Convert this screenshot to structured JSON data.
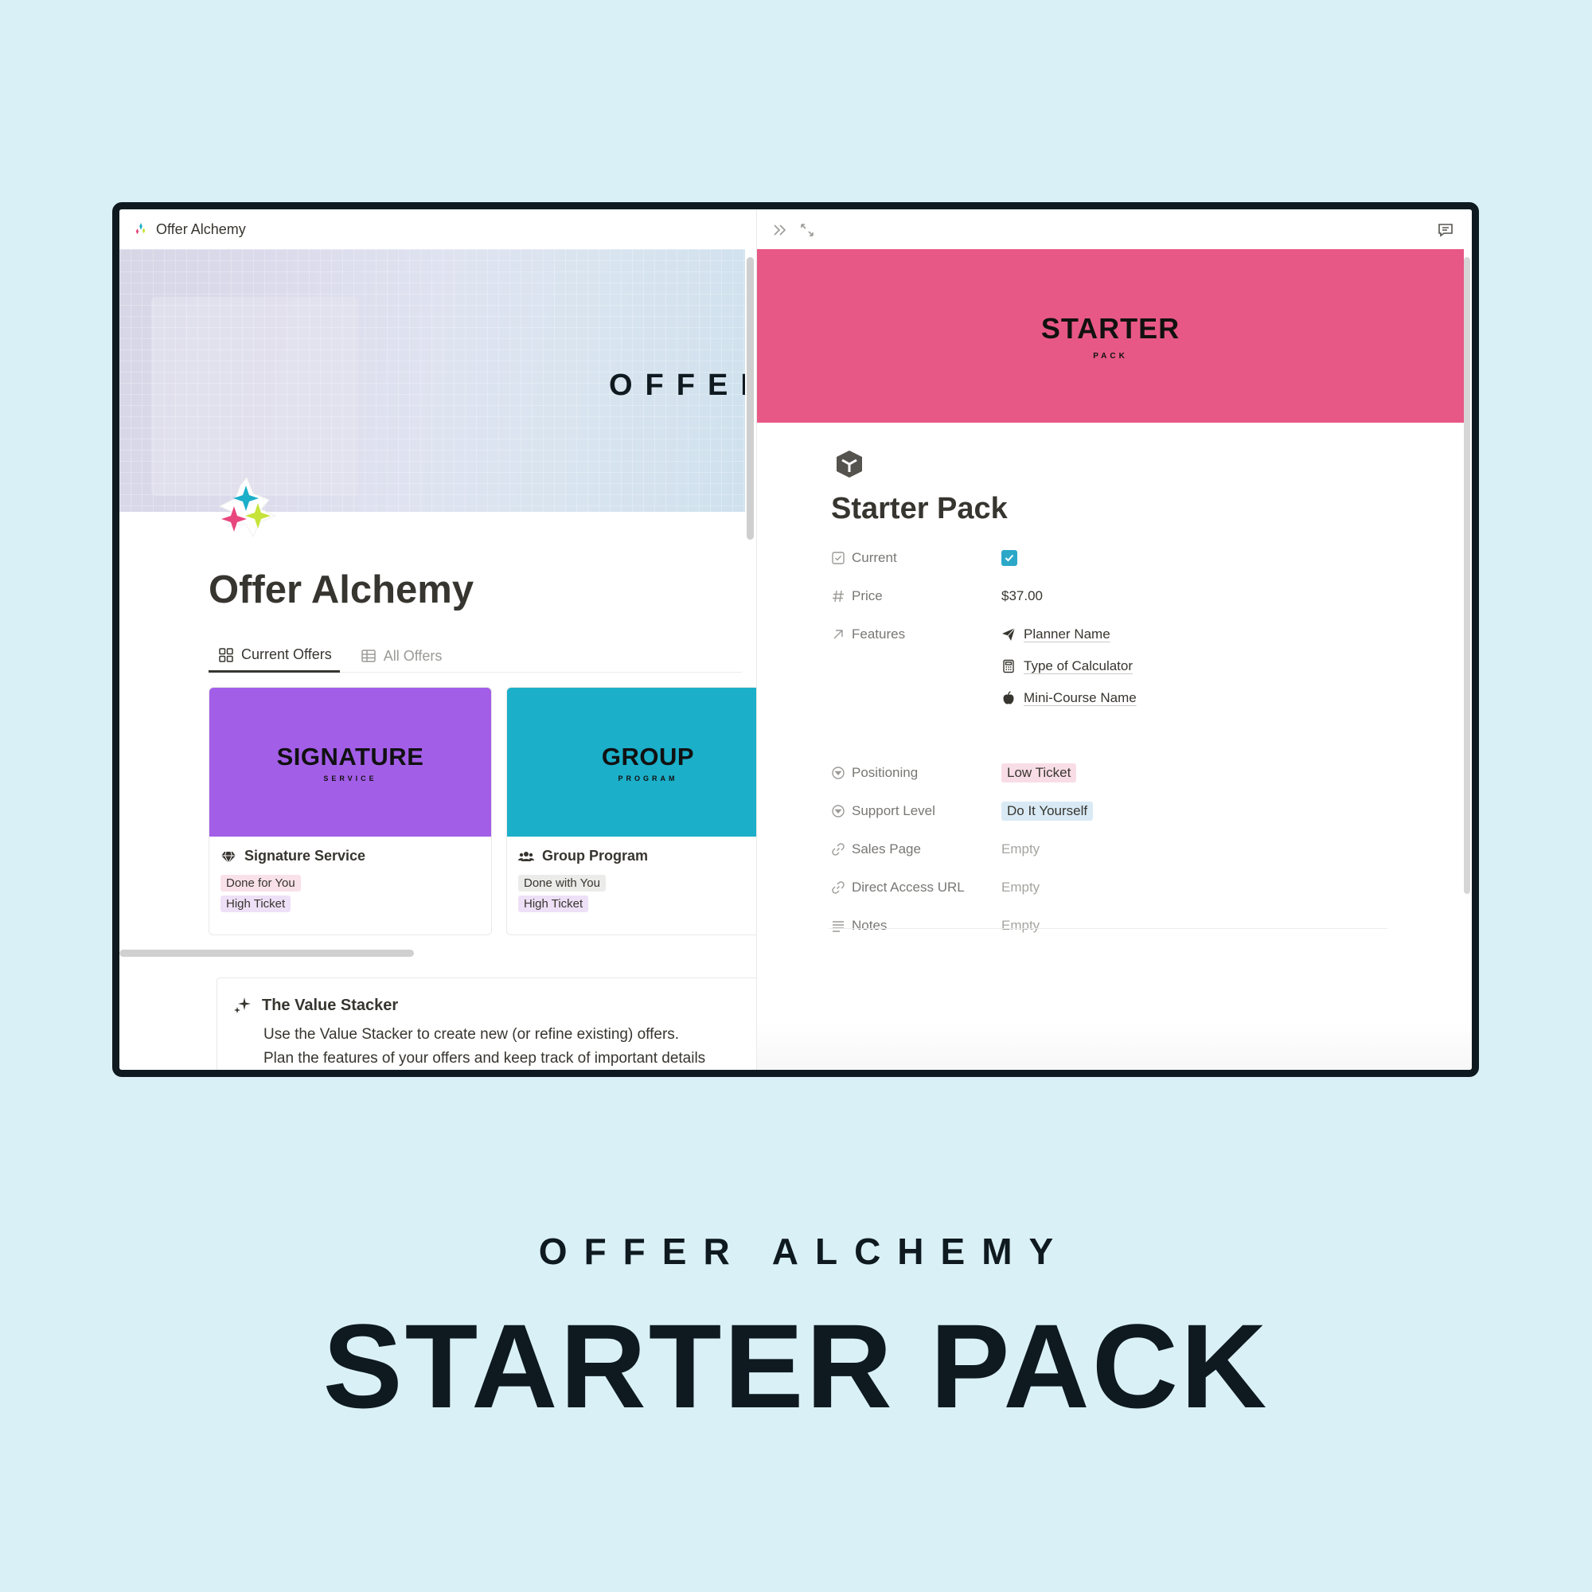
{
  "app": {
    "breadcrumb_title": "Offer Alchemy"
  },
  "left": {
    "cover_word": "OFFER",
    "page_title": "Offer Alchemy",
    "tabs": [
      {
        "label": "Current Offers",
        "active": true,
        "icon": "gallery-icon"
      },
      {
        "label": "All Offers",
        "active": false,
        "icon": "table-icon"
      }
    ],
    "cards": [
      {
        "banner_big": "SIGNATURE",
        "banner_small": "SERVICE",
        "banner_color": "#a35ee8",
        "name": "Signature Service",
        "icon": "diamond-icon",
        "tags": [
          "Done for You",
          "High Ticket"
        ]
      },
      {
        "banner_big": "GROUP",
        "banner_small": "PROGRAM",
        "banner_color": "#1bafc9",
        "name": "Group Program",
        "icon": "people-icon",
        "tags": [
          "Done with You",
          "High Ticket"
        ]
      }
    ],
    "callout": {
      "title": "The Value Stacker",
      "line1": "Use the Value Stacker to create new (or refine existing) offers.",
      "line2": "Plan the features of your offers and keep track of important details"
    }
  },
  "right": {
    "cover_big": "STARTER",
    "cover_small": "PACK",
    "cover_color": "#e85886",
    "title": "Starter Pack",
    "properties": {
      "current": {
        "label": "Current",
        "checked": true
      },
      "price": {
        "label": "Price",
        "value": "$37.00"
      },
      "features": {
        "label": "Features",
        "items": [
          {
            "name": "Planner Name",
            "icon": "paper-plane-icon"
          },
          {
            "name": "Type of Calculator",
            "icon": "calculator-icon"
          },
          {
            "name": "Mini-Course Name",
            "icon": "apple-icon"
          }
        ]
      },
      "positioning": {
        "label": "Positioning",
        "value": "Low Ticket"
      },
      "support_level": {
        "label": "Support Level",
        "value": "Do It Yourself"
      },
      "sales_page": {
        "label": "Sales Page",
        "value": "Empty"
      },
      "direct_access_url": {
        "label": "Direct Access URL",
        "value": "Empty"
      },
      "notes": {
        "label": "Notes",
        "value": "Empty"
      }
    }
  },
  "footer": {
    "subtitle": "OFFER ALCHEMY",
    "title": "STARTER PACK"
  },
  "colors": {
    "background": "#d9f0f6",
    "frame": "#0e1a1f",
    "checkbox": "#2ba8c8"
  }
}
